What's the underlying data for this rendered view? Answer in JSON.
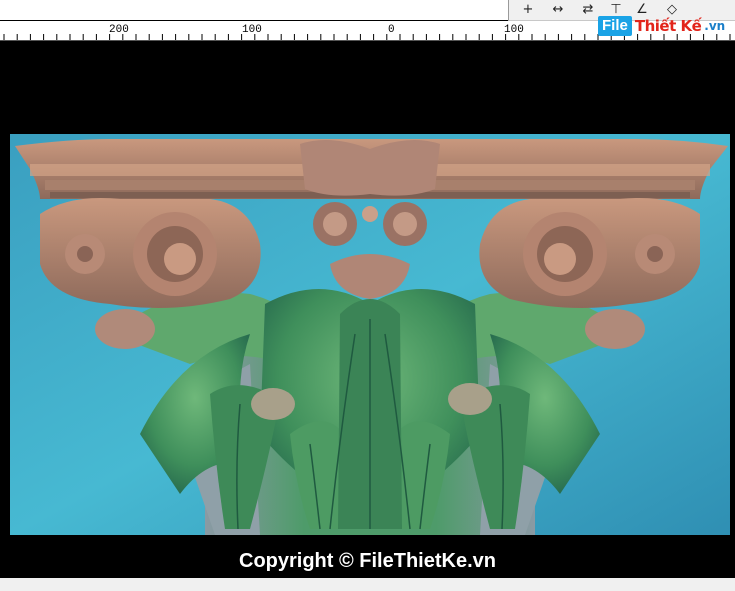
{
  "toolbar": {
    "buttons": [
      {
        "name": "crosshair-icon",
        "glyph": "+"
      },
      {
        "name": "measure-width-icon",
        "glyph": "↔"
      },
      {
        "name": "transform-icon",
        "glyph": "⇄"
      },
      {
        "name": "dimension-icon",
        "glyph": "⊤"
      },
      {
        "name": "angle-icon",
        "glyph": "∠"
      },
      {
        "name": "rotate-view-icon",
        "glyph": "◇"
      }
    ]
  },
  "ruler": {
    "labels": [
      "200",
      "100",
      "0",
      "100"
    ]
  },
  "logo": {
    "file": "File",
    "thietke": "Thiết Kế",
    "vn": ".vn"
  },
  "viewport": {
    "background_color": "#3fb3cf"
  },
  "copyright": "Copyright © FileThietKe.vn"
}
